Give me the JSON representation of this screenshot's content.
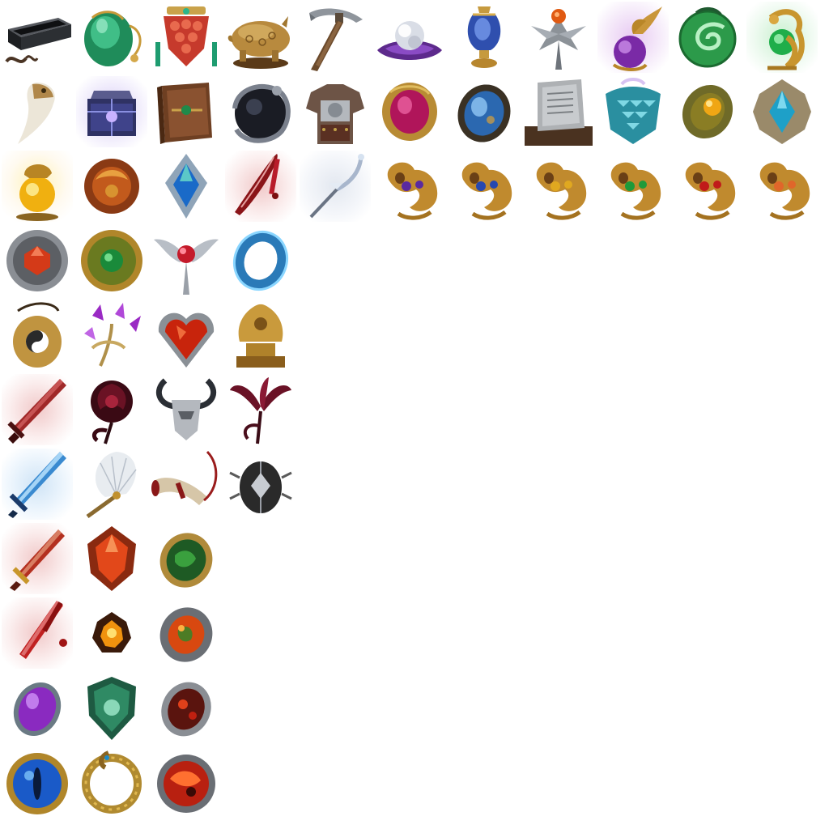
{
  "sheet": {
    "description_colors": {
      "gold": "#b8862b",
      "dark_gold": "#6e4a14",
      "silver": "#a9afb8",
      "dark_iron": "#3c3f45",
      "jade": "#2f9b57",
      "ruby": "#b81d1d",
      "amethyst": "#8a2fc0",
      "sapphire": "#2b7bd0"
    }
  },
  "icons": [
    {
      "name": "black-box-icon"
    },
    {
      "name": "jade-gourd-icon"
    },
    {
      "name": "red-lantern-icon"
    },
    {
      "name": "golden-pig-icon"
    },
    {
      "name": "pickaxe-icon"
    },
    {
      "name": "pearl-icon"
    },
    {
      "name": "blue-urn-icon"
    },
    {
      "name": "silver-leaf-icon"
    },
    {
      "name": "phoenix-orb-icon"
    },
    {
      "name": "jade-spiral-icon"
    },
    {
      "name": "golden-dragon-orb-icon"
    },
    {
      "name": "fang-icon"
    },
    {
      "name": "purple-chest-icon"
    },
    {
      "name": "brown-book-icon"
    },
    {
      "name": "dragon-sphere-icon"
    },
    {
      "name": "armor-icon"
    },
    {
      "name": "ruby-brooch-icon"
    },
    {
      "name": "opal-brooch-icon"
    },
    {
      "name": "stone-tablet-icon"
    },
    {
      "name": "scale-ornament-icon"
    },
    {
      "name": "amber-ring-icon"
    },
    {
      "name": "aqua-gem-icon"
    },
    {
      "name": "tiger-orb-icon"
    },
    {
      "name": "bronze-sphere-icon"
    },
    {
      "name": "blue-crystal-icon"
    },
    {
      "name": "red-blade-icon"
    },
    {
      "name": "frost-staff-icon"
    },
    {
      "name": "beast-purple-icon"
    },
    {
      "name": "beast-blue-icon"
    },
    {
      "name": "beast-gold-icon"
    },
    {
      "name": "beast-green-icon"
    },
    {
      "name": "beast-red-icon"
    },
    {
      "name": "beast-orange-icon"
    },
    {
      "name": "ruby-medallion-icon"
    },
    {
      "name": "emerald-medallion-icon"
    },
    {
      "name": "winged-ruby-icon"
    },
    {
      "name": "blue-ring-icon"
    },
    {
      "name": "yinyang-pendant-icon"
    },
    {
      "name": "crystal-flower-icon"
    },
    {
      "name": "heart-gem-icon"
    },
    {
      "name": "golden-idol-icon"
    },
    {
      "name": "crimson-sword-icon"
    },
    {
      "name": "black-rose-icon"
    },
    {
      "name": "horned-helm-icon"
    },
    {
      "name": "dark-lily-icon"
    },
    {
      "name": "ice-sword-icon"
    },
    {
      "name": "feather-fan-icon"
    },
    {
      "name": "war-horn-icon"
    },
    {
      "name": "scarab-icon"
    },
    {
      "name": "blood-dagger-icon"
    },
    {
      "name": "flame-gem-icon"
    },
    {
      "name": "moss-stone-icon"
    },
    {
      "name": "red-tassel-sword-icon"
    },
    {
      "name": "fire-shard-icon"
    },
    {
      "name": "lava-amulet-icon"
    },
    {
      "name": "violet-egg-icon"
    },
    {
      "name": "jade-shield-icon"
    },
    {
      "name": "ember-brooch-icon"
    },
    {
      "name": "dragon-eye-icon"
    },
    {
      "name": "ouroboros-icon"
    },
    {
      "name": "magma-sphere-icon"
    }
  ]
}
